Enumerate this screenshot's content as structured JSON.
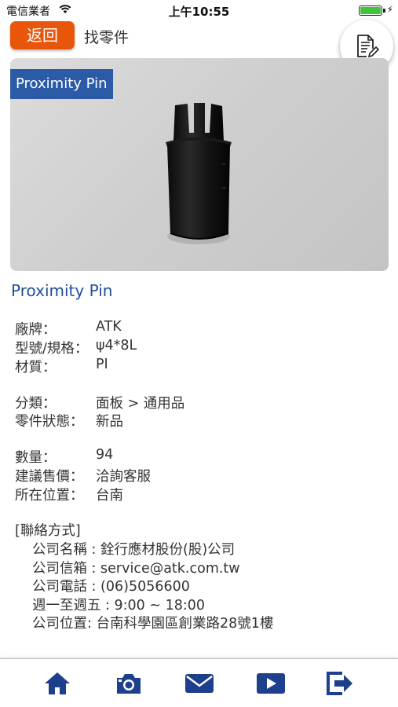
{
  "status_bar": {
    "carrier": "電信業者",
    "time": "上午10:55"
  },
  "nav": {
    "back_label": "返回",
    "title": "找零件"
  },
  "product": {
    "image_label": "Proximity Pin",
    "name": "Proximity Pin"
  },
  "details": {
    "brand_label": "廠牌：",
    "brand_value": "ATK",
    "model_label": "型號/規格：",
    "model_value": "ψ4*8L",
    "material_label": "材質：",
    "material_value": "PI",
    "category_label": "分類：",
    "category_value": "面板 > 通用品",
    "condition_label": "零件狀態：",
    "condition_value": "新品",
    "quantity_label": "數量：",
    "quantity_value": "94",
    "price_label": "建議售價：",
    "price_value": "洽詢客服",
    "location_label": "所在位置：",
    "location_value": "台南"
  },
  "contact": {
    "header": "[聯絡方式]",
    "company": "公司名稱 : 銓行應材股份(股)公司",
    "email": "公司信箱 : service@atk.com.tw",
    "phone": "公司電話 : (06)5056600",
    "hours": "週一至週五 : 9:00 ~ 18:00",
    "address": "公司位置: 台南科學園區創業路28號1樓"
  },
  "tab_bar": {
    "icons": [
      "home-icon",
      "camera-icon",
      "mail-icon",
      "play-icon",
      "exit-icon"
    ],
    "color": "#1d3f8c"
  },
  "colors": {
    "accent": "#e8560b",
    "brand_blue": "#2b5aa6",
    "title_blue": "#1f4f9a"
  }
}
